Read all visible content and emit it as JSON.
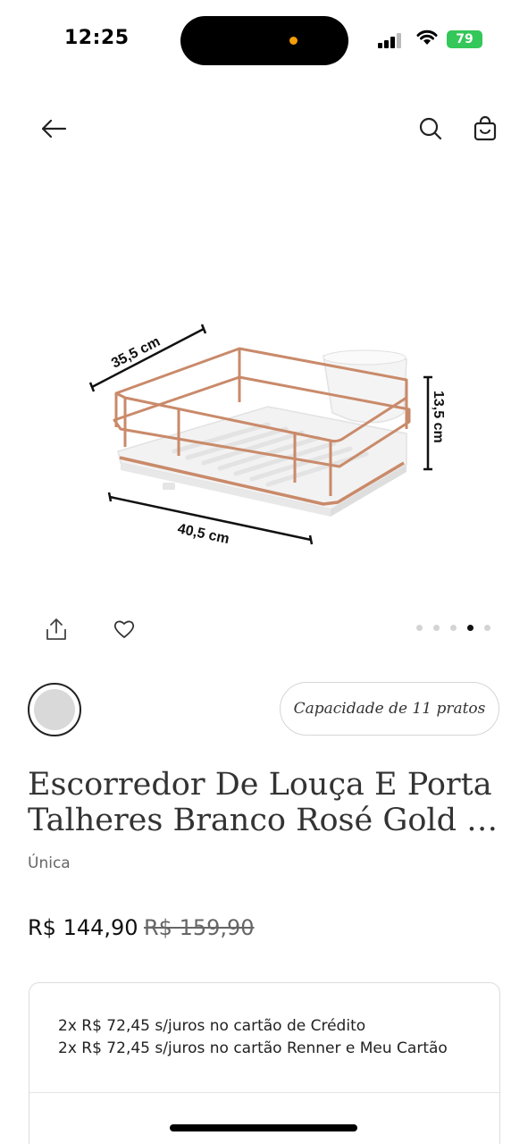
{
  "status_bar": {
    "time": "12:25",
    "battery": "79"
  },
  "header": {
    "back_icon": "arrow-left-icon",
    "search_icon": "search-icon",
    "bag_icon": "shopping-bag-icon"
  },
  "image": {
    "dimension_depth": "35,5 cm",
    "dimension_width": "40,5 cm",
    "dimension_height": "13,5 cm"
  },
  "actions": {
    "share_icon": "share-icon",
    "favorite_icon": "heart-icon"
  },
  "pager": {
    "total": 5,
    "active_index": 3
  },
  "variant": {
    "swatch_color": "#d9d9d9",
    "capacity_label": "Capacidade de 11 pratos"
  },
  "product": {
    "title_line1": "Escorredor De Louça E Porta",
    "title_line2": "Talheres Branco Rosé Gold B...",
    "size": "Única",
    "price": "R$ 144,90",
    "old_price": "R$ 159,90"
  },
  "installments": {
    "line1": "2x R$ 72,45 s/juros no cartão de Crédito",
    "line2": "2x R$ 72,45 s/juros no cartão Renner e Meu Cartão"
  },
  "colors": {
    "accent": "#c98a6a",
    "status_green": "#34c759"
  }
}
